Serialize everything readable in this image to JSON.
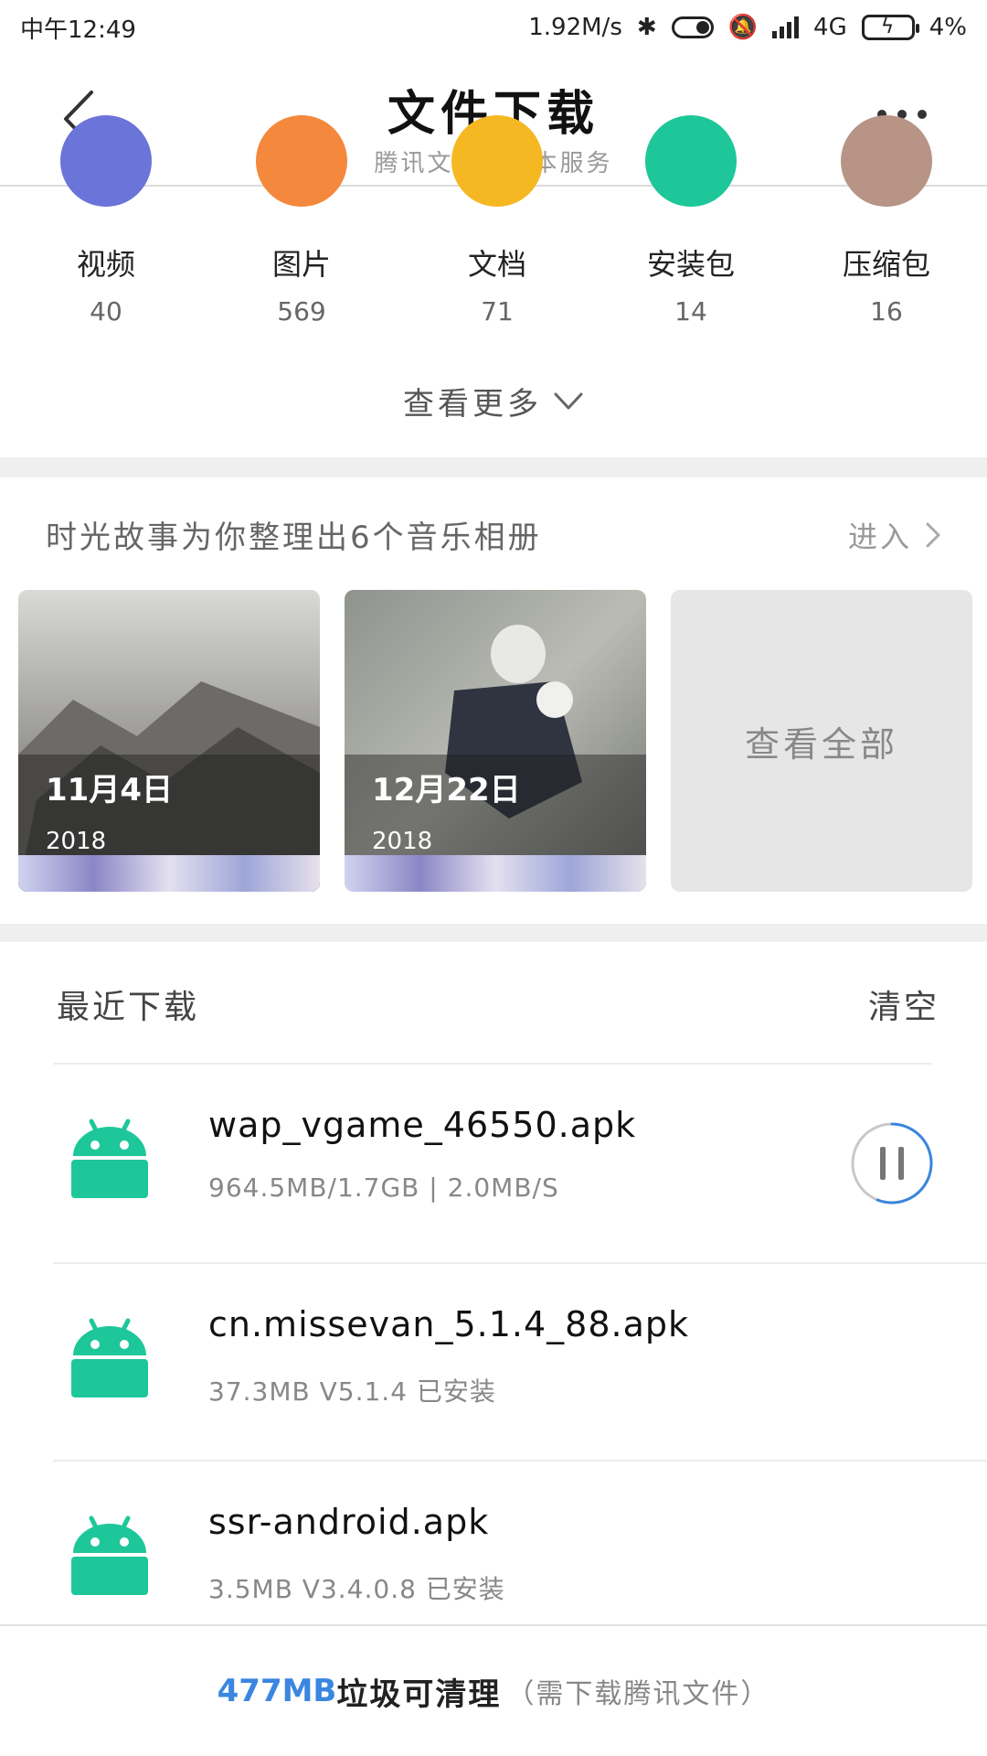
{
  "status_bar": {
    "time": "中午12:49",
    "net_speed": "1.92M/s",
    "network": "4G",
    "battery": "4%"
  },
  "header": {
    "title": "文件下载",
    "subtitle": "腾讯文件提供本服务"
  },
  "categories": [
    {
      "label": "视频",
      "count": "40",
      "color": "#6b74d8"
    },
    {
      "label": "图片",
      "count": "569",
      "color": "#f4883c"
    },
    {
      "label": "文档",
      "count": "71",
      "color": "#f5b823"
    },
    {
      "label": "安装包",
      "count": "14",
      "color": "#1ec79a"
    },
    {
      "label": "压缩包",
      "count": "16",
      "color": "#b79485"
    }
  ],
  "see_more": "查看更多",
  "albums": {
    "title": "时光故事为你整理出6个音乐相册",
    "enter": "进入",
    "items": [
      {
        "date": "11月4日",
        "year": "2018"
      },
      {
        "date": "12月22日",
        "year": "2018"
      }
    ],
    "view_all": "查看全部"
  },
  "recent": {
    "title": "最近下载",
    "clear": "清空",
    "items": [
      {
        "name": "wap_vgame_46550.apk",
        "meta": "964.5MB/1.7GB | 2.0MB/S",
        "progress": 0.56
      },
      {
        "name": "cn.missevan_5.1.4_88.apk",
        "meta": "37.3MB  V5.1.4 已安装"
      },
      {
        "name": "ssr-android.apk",
        "meta": "3.5MB  V3.4.0.8 已安装"
      }
    ]
  },
  "bottom": {
    "size": "477MB",
    "text": "垃圾可清理",
    "note": "（需下载腾讯文件）"
  },
  "colors": {
    "accent_blue": "#3a86e0",
    "android_green": "#1ec79a"
  }
}
